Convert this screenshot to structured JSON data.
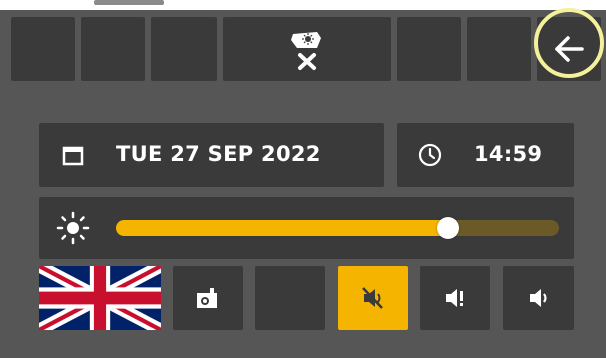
{
  "colors": {
    "panel": "#565656",
    "button": "#3a3a3a",
    "accent": "#f5b400",
    "track_remaining": "#6b5a27",
    "highlight": "#f4f19a"
  },
  "toolbar": {
    "tiles": [
      {
        "id": "tile-1",
        "icon": "blank"
      },
      {
        "id": "tile-2",
        "icon": "blank"
      },
      {
        "id": "tile-3",
        "icon": "blank"
      },
      {
        "id": "display-off",
        "icon": "display-brightness-close-icon"
      },
      {
        "id": "tile-5",
        "icon": "blank"
      },
      {
        "id": "tile-6",
        "icon": "blank"
      },
      {
        "id": "back",
        "icon": "arrow-left-icon"
      }
    ]
  },
  "datetime": {
    "date_label": "TUE 27 SEP 2022",
    "time_label": "14:59",
    "date_icon": "calendar-icon",
    "time_icon": "clock-icon"
  },
  "brightness": {
    "icon": "brightness-icon",
    "value_fraction": 0.75
  },
  "bottom_row": {
    "language_flag": "uk-flag-icon",
    "buttons": [
      {
        "id": "camera",
        "icon": "camera-icon"
      },
      {
        "id": "blank",
        "icon": "blank"
      },
      {
        "id": "mute",
        "icon": "speaker-muted-icon",
        "active": true
      },
      {
        "id": "alert-volume",
        "icon": "speaker-alert-icon"
      },
      {
        "id": "volume",
        "icon": "speaker-icon"
      }
    ]
  }
}
